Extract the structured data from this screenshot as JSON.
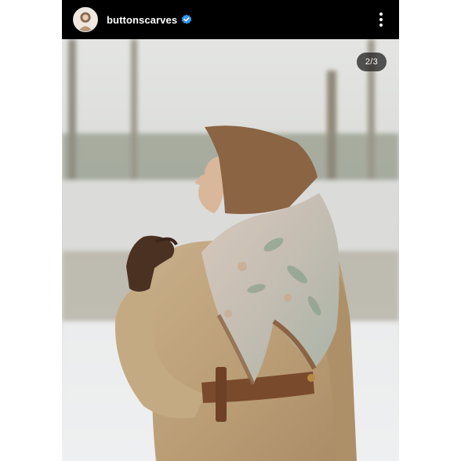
{
  "post": {
    "username": "buttonscarves",
    "verified": true,
    "carousel_counter": "2/3"
  },
  "icons": {
    "avatar": "profile-avatar",
    "verified": "verified-badge-icon",
    "more": "more-options-icon"
  },
  "colors": {
    "header_bg": "#000000",
    "verified_blue": "#3897f0",
    "counter_bg": "#262626"
  }
}
